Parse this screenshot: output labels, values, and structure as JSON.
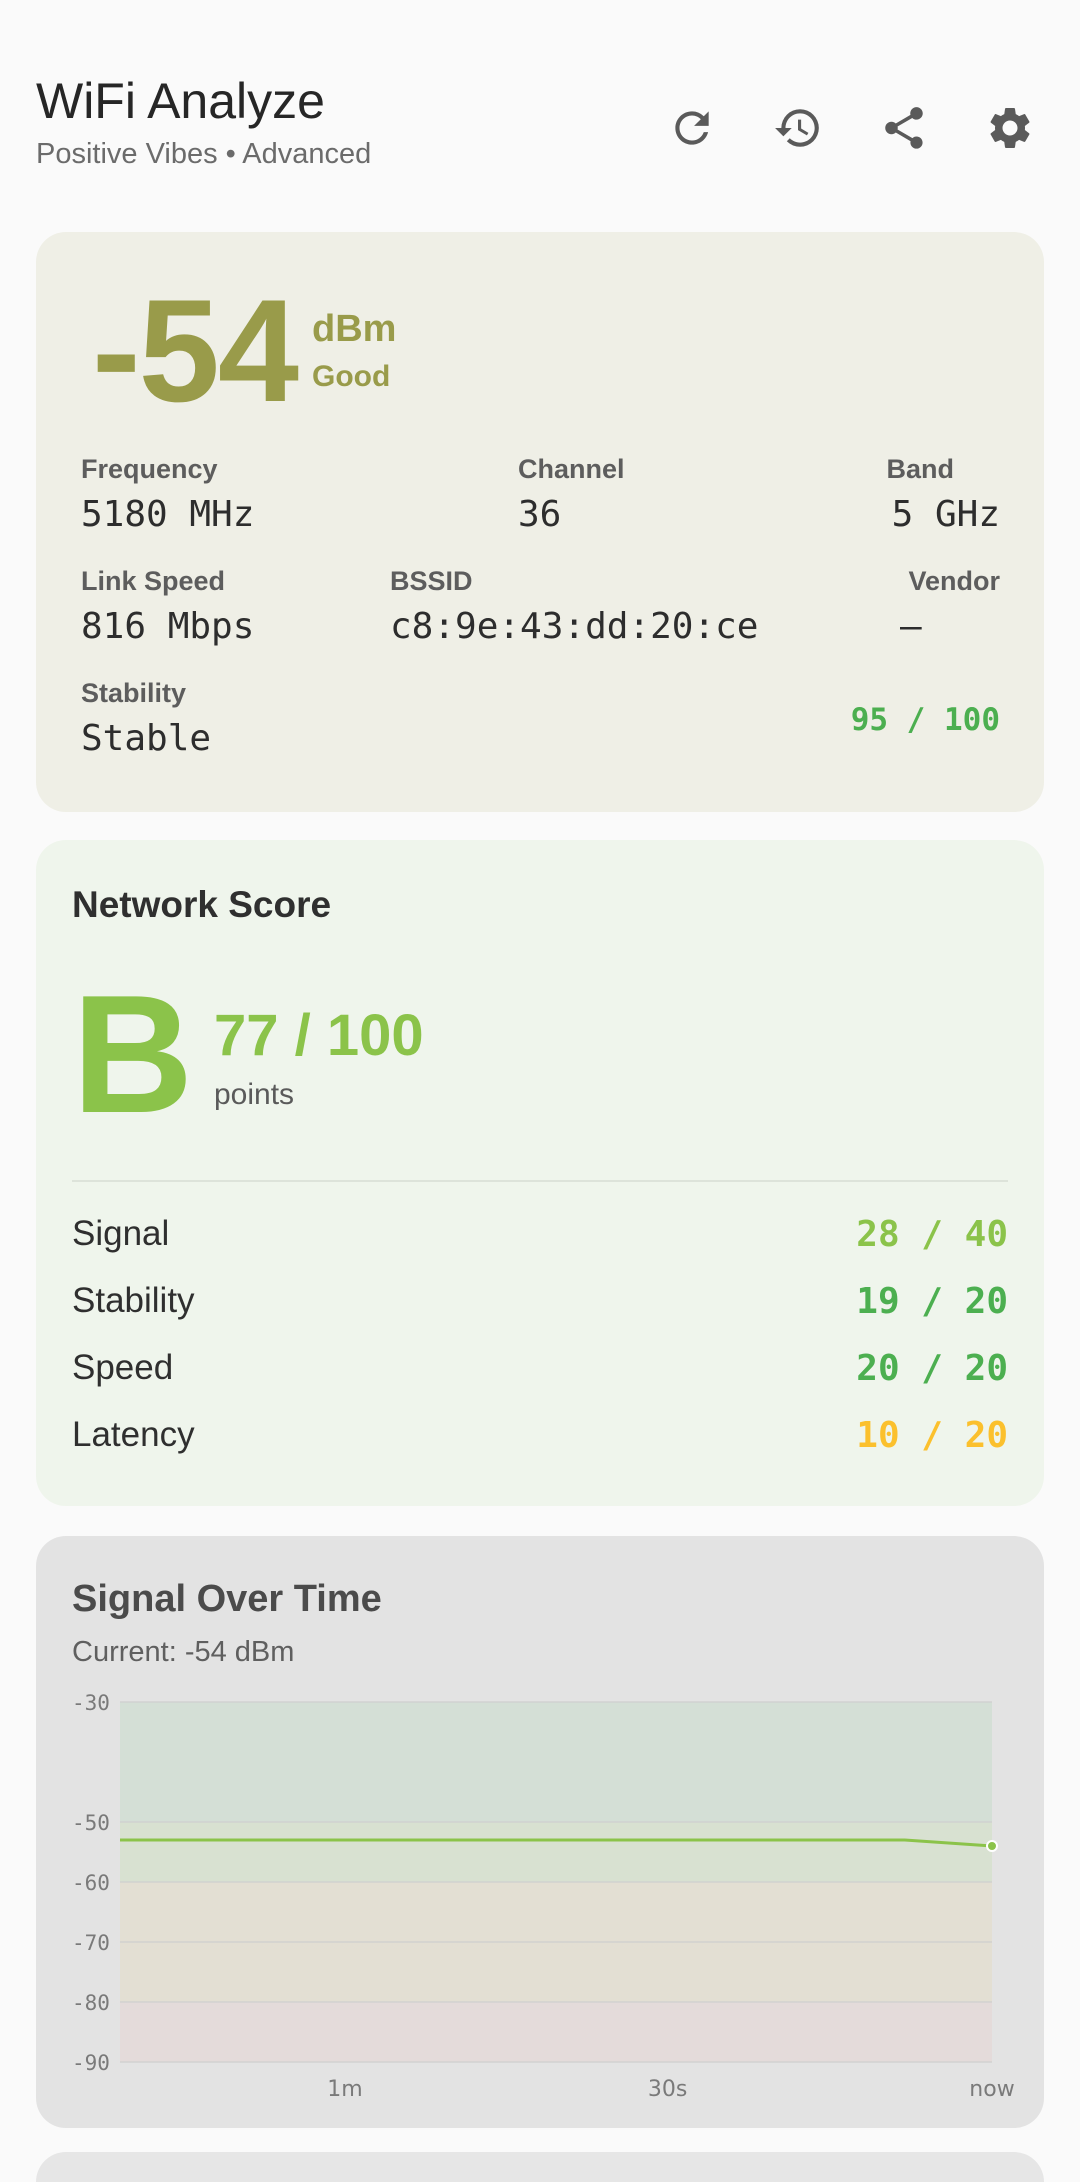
{
  "header": {
    "title": "WiFi Analyze",
    "subtitle": "Positive Vibes • Advanced",
    "actions": [
      {
        "name": "refresh",
        "icon": "refresh-icon"
      },
      {
        "name": "history",
        "icon": "history-icon"
      },
      {
        "name": "share",
        "icon": "share-icon"
      },
      {
        "name": "settings",
        "icon": "gear-icon"
      }
    ]
  },
  "signal": {
    "rssi": "-54",
    "unit": "dBm",
    "quality": "Good",
    "color": "#999b4a",
    "frequency_label": "Frequency",
    "frequency_value": "5180 MHz",
    "channel_label": "Channel",
    "channel_value": "36",
    "band_label": "Band",
    "band_value": "5 GHz",
    "link_speed_label": "Link Speed",
    "link_speed_value": "816 Mbps",
    "bssid_label": "BSSID",
    "bssid_value": "c8:9e:43:dd:20:ce",
    "vendor_label": "Vendor",
    "vendor_value": "—",
    "stability_label": "Stability",
    "stability_value": "Stable",
    "stability_score": "95 / 100"
  },
  "score": {
    "title": "Network Score",
    "grade": "B",
    "total": "77 / 100",
    "points_label": "points",
    "rows": [
      {
        "label": "Signal",
        "value": "28 / 40",
        "color": "#8bc34a"
      },
      {
        "label": "Stability",
        "value": "19 / 20",
        "color": "#4caf50"
      },
      {
        "label": "Speed",
        "value": "20 / 20",
        "color": "#4caf50"
      },
      {
        "label": "Latency",
        "value": "10 / 20",
        "color": "#fbc02d"
      }
    ]
  },
  "chart": {
    "title": "Signal Over Time",
    "current": "Current: -54 dBm"
  },
  "chart_data": {
    "type": "line",
    "title": "Signal Over Time",
    "ylim": [
      -90,
      -30
    ],
    "y_ticks": [
      "-30",
      "-50",
      "-60",
      "-70",
      "-80",
      "-90"
    ],
    "y_tick_values": [
      -30,
      -50,
      -60,
      -70,
      -80,
      -90
    ],
    "x_ticks": [
      "1m",
      "30s",
      "now"
    ],
    "x_tick_positions": [
      0.258,
      0.628,
      1.0
    ],
    "series": [
      {
        "values": [
          -53,
          -53,
          -53,
          -53,
          -53,
          -53,
          -53,
          -53,
          -53,
          -53,
          -54
        ],
        "color": "#8bc34a"
      }
    ],
    "zones": [
      {
        "from": -50,
        "to": -30,
        "color": "#c8dccc"
      },
      {
        "from": -60,
        "to": -50,
        "color": "#cfe0c2"
      },
      {
        "from": -80,
        "to": -60,
        "color": "#e3ddc6"
      },
      {
        "from": -90,
        "to": -80,
        "color": "#e6d6d4"
      }
    ],
    "grid": true
  }
}
